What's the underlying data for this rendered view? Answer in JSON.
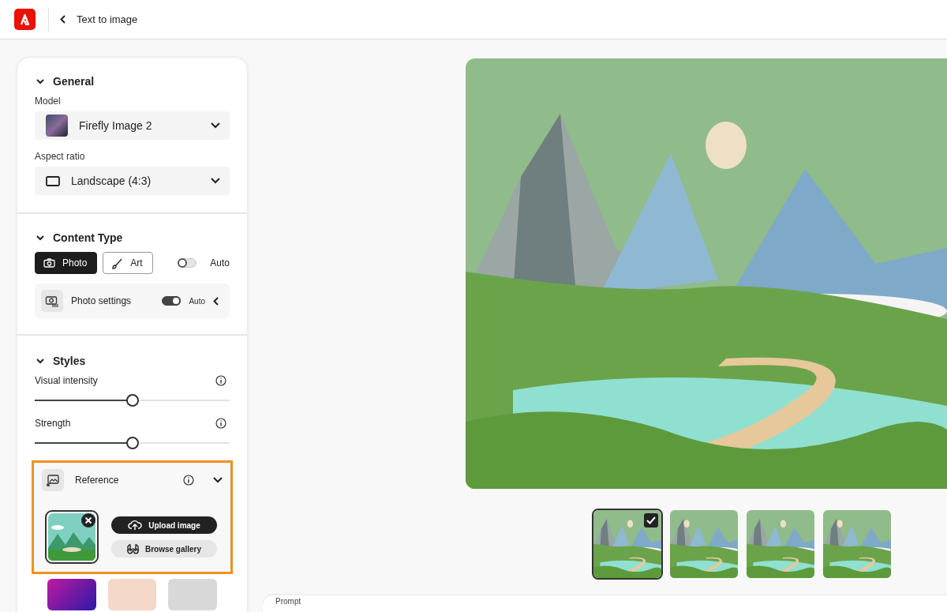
{
  "header": {
    "title": "Text to image"
  },
  "general": {
    "title": "General",
    "expanded": true,
    "model_label": "Model",
    "model_value": "Firefly Image 2",
    "aspect_label": "Aspect ratio",
    "aspect_value": "Landscape (4:3)"
  },
  "content_type": {
    "title": "Content Type",
    "expanded": true,
    "options": [
      {
        "kind": "photo",
        "label": "Photo",
        "selected": true
      },
      {
        "kind": "art",
        "label": "Art",
        "selected": false
      }
    ],
    "auto_toggle": {
      "label": "Auto",
      "on": false
    },
    "photo_settings": {
      "label": "Photo settings",
      "toggle_label": "Auto",
      "on": true
    }
  },
  "styles": {
    "title": "Styles",
    "expanded": true,
    "sliders": [
      {
        "label": "Visual intensity",
        "level": 0.5
      },
      {
        "label": "Strength",
        "level": 0.5
      }
    ],
    "reference": {
      "title": "Reference",
      "expanded": true,
      "upload_button": "Upload image",
      "browse_button": "Browse gallery"
    }
  },
  "thumbnails": [
    {
      "selected": true
    },
    {
      "selected": false
    },
    {
      "selected": false
    },
    {
      "selected": false
    }
  ],
  "prompt": {
    "label": "Prompt"
  }
}
